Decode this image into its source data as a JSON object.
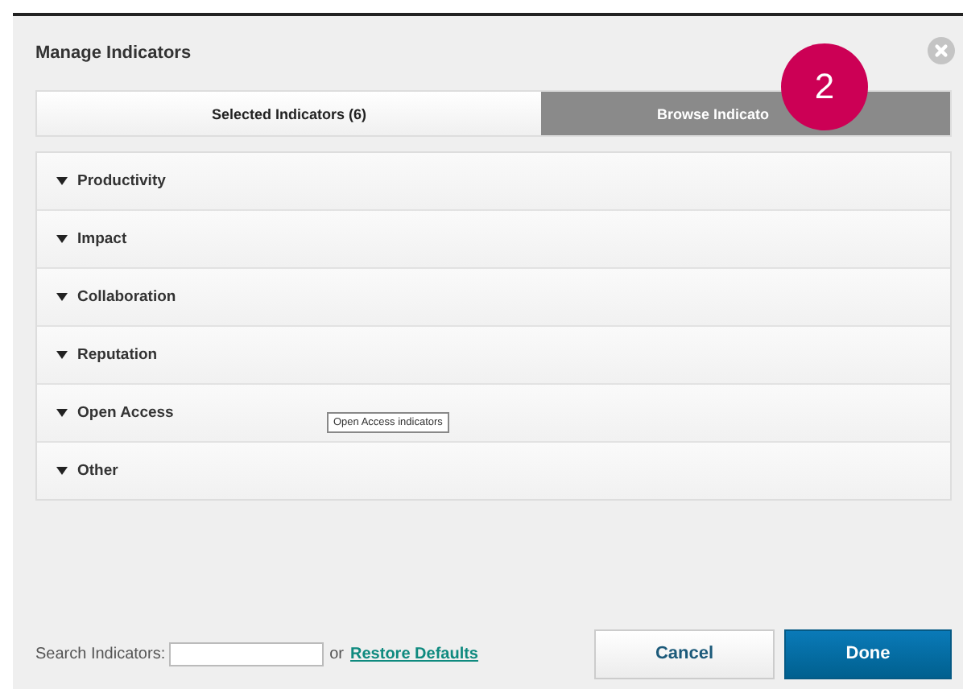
{
  "dialog": {
    "title": "Manage Indicators"
  },
  "tabs": [
    {
      "label": "Selected Indicators (6)",
      "selected": false
    },
    {
      "label": "Browse Indicato",
      "selected": true
    }
  ],
  "step_badge": "2",
  "groups": [
    {
      "label": "Productivity"
    },
    {
      "label": "Impact"
    },
    {
      "label": "Collaboration"
    },
    {
      "label": "Reputation"
    },
    {
      "label": "Open Access",
      "tooltip": "Open Access indicators"
    },
    {
      "label": "Other"
    }
  ],
  "footer": {
    "search_label": "Search Indicators:",
    "or": "or",
    "restore_link": "Restore Defaults",
    "buttons": [
      {
        "label": "Cancel",
        "kind": "secondary"
      },
      {
        "label": "Done",
        "kind": "primary"
      }
    ]
  }
}
